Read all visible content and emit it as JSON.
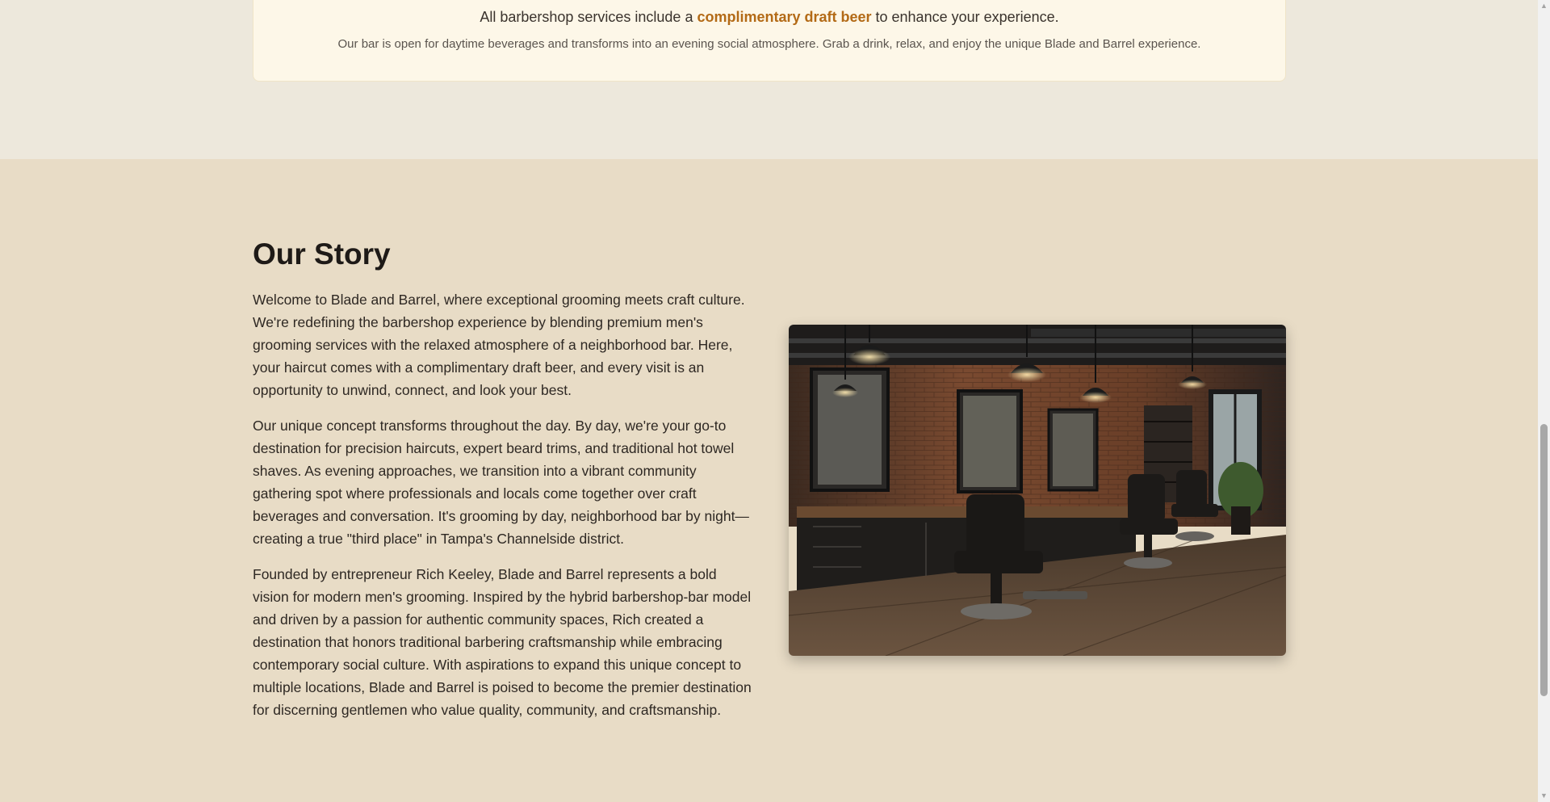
{
  "services_note": {
    "line1_before": "All barbershop services include a ",
    "line1_highlight": "complimentary draft beer",
    "line1_after": " to enhance your experience.",
    "line2": "Our bar is open for daytime beverages and transforms into an evening social atmosphere. Grab a drink, relax, and enjoy the unique Blade and Barrel experience."
  },
  "story": {
    "title": "Our Story",
    "paragraphs": [
      "Welcome to Blade and Barrel, where exceptional grooming meets craft culture. We're redefining the barbershop experience by blending premium men's grooming services with the relaxed atmosphere of a neighborhood bar. Here, your haircut comes with a complimentary draft beer, and every visit is an opportunity to unwind, connect, and look your best.",
      "Our unique concept transforms throughout the day. By day, we're your go-to destination for precision haircuts, expert beard trims, and traditional hot towel shaves. As evening approaches, we transition into a vibrant community gathering spot where professionals and locals come together over craft beverages and conversation. It's grooming by day, neighborhood bar by night—creating a true \"third place\" in Tampa's Channelside district.",
      "Founded by entrepreneur Rich Keeley, Blade and Barrel represents a bold vision for modern men's grooming. Inspired by the hybrid barbershop-bar model and driven by a passion for authentic community spaces, Rich created a destination that honors traditional barbering craftsmanship while embracing contemporary social culture. With aspirations to expand this unique concept to multiple locations, Blade and Barrel is poised to become the premier destination for discerning gentlemen who value quality, community, and craftsmanship."
    ]
  },
  "colors": {
    "highlight": "#b36a16",
    "story_background": "#e8dcc6",
    "services_background": "#ede8dc",
    "note_background": "#fdf7e8"
  },
  "icons": {
    "scroll_up": "triangle-up",
    "scroll_down": "triangle-down"
  }
}
